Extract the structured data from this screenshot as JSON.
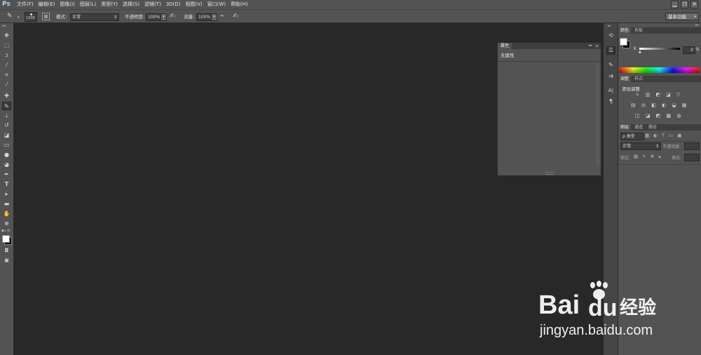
{
  "app": {
    "logo": "Ps"
  },
  "menubar": {
    "items": [
      "文件(F)",
      "编辑(E)",
      "图像(I)",
      "图层(L)",
      "类型(Y)",
      "选择(S)",
      "滤镜(T)",
      "3D(D)",
      "视图(V)",
      "窗口(W)",
      "帮助(H)"
    ]
  },
  "window_controls": {
    "minimize": "▁",
    "restore": "❐",
    "close": "✕"
  },
  "options_bar": {
    "brush_size": "1330",
    "mode_label": "模式:",
    "mode_value": "正常",
    "opacity_label": "不透明度:",
    "opacity_value": "100%",
    "flow_label": "流量:",
    "flow_value": "100%",
    "workspace": "基本功能"
  },
  "properties_panel": {
    "tab": "属性",
    "collapse_glyph": "▸▸",
    "menu_glyph": "≡",
    "content": "无属性"
  },
  "color_panel": {
    "tabs": [
      "颜色",
      "色板"
    ],
    "k_label": "K",
    "k_value": "0",
    "percent": "%"
  },
  "adjustments_panel": {
    "tabs": [
      "调整",
      "样式"
    ],
    "title": "添加调整"
  },
  "layers_panel": {
    "tabs": [
      "图层",
      "通道",
      "路径"
    ],
    "filter_label": "ρ 类型",
    "blend_mode": "正常",
    "opacity_label": "不透明度:",
    "lock_label": "锁定:",
    "fill_label": "填充:"
  },
  "watermark": {
    "brand": "Bai",
    "brand_tail": "经验",
    "url": "jingyan.baidu.com"
  }
}
